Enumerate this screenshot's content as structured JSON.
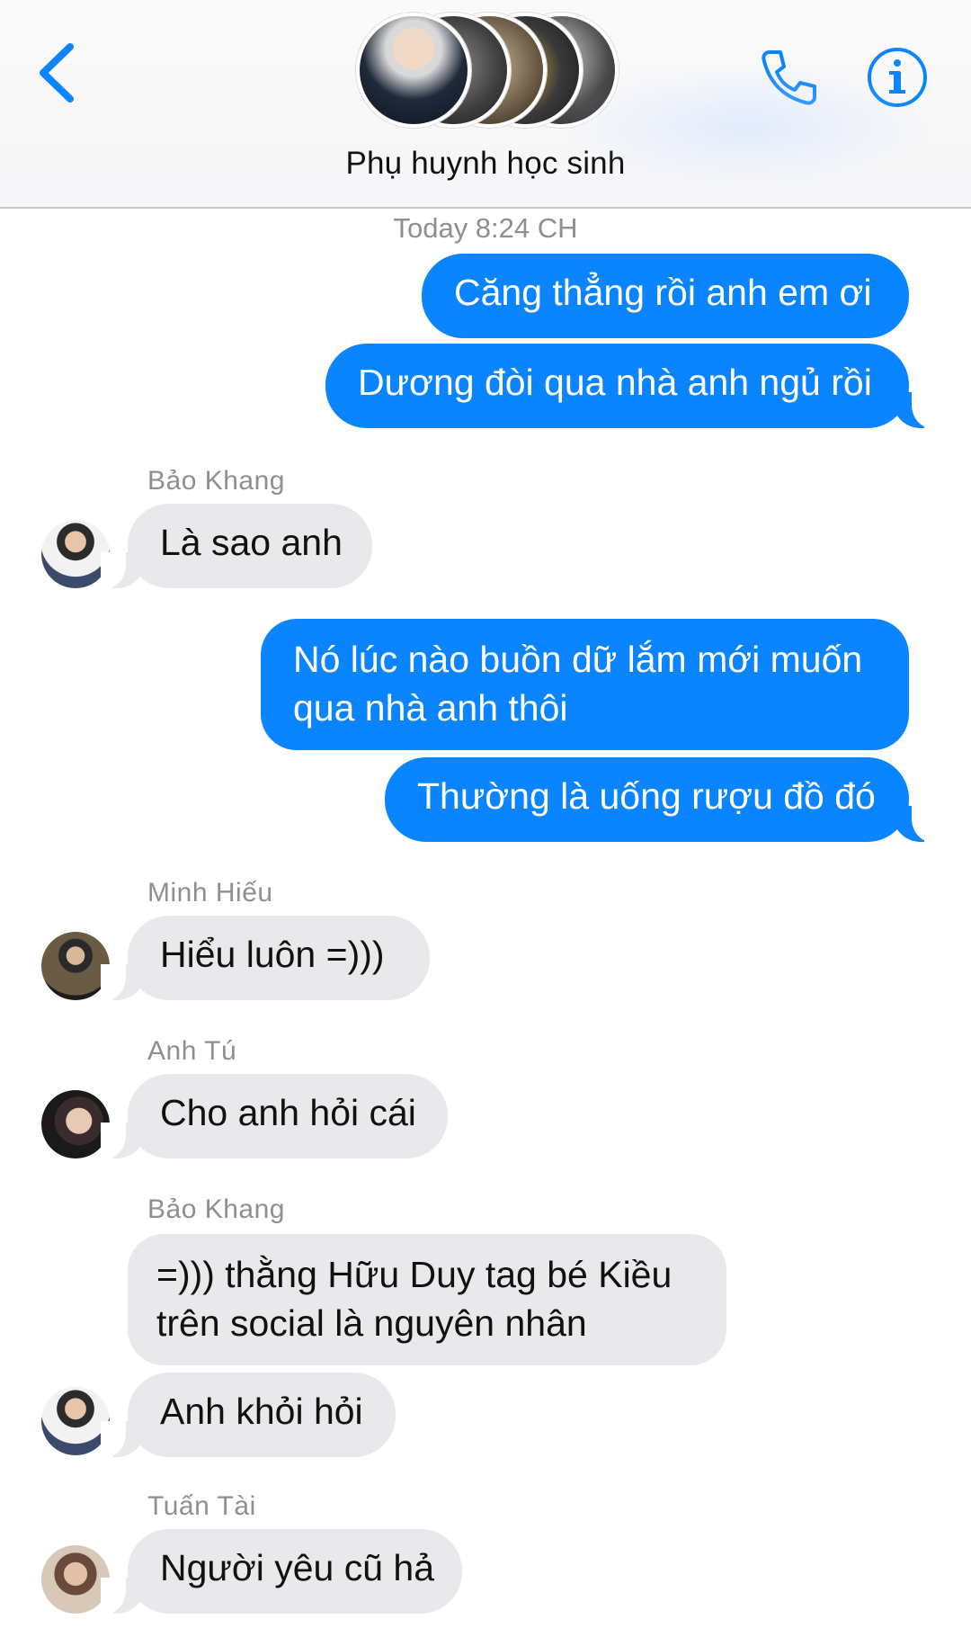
{
  "header": {
    "back_icon": "chevron-left-icon",
    "call_icon": "phone-icon",
    "info_icon": "info-icon",
    "group_name": "Phụ huynh học sinh",
    "accent": "#0a84ff"
  },
  "timestamp": "Today 8:24 CH",
  "messages": [
    {
      "dir": "out",
      "text": "Căng thẳng rồi anh em ơi"
    },
    {
      "dir": "out",
      "text": "Dương đòi qua nhà anh ngủ rồi"
    },
    {
      "dir": "in",
      "sender": "Bảo Khang",
      "text": "Là sao anh"
    },
    {
      "dir": "out",
      "text_line1": "Nó lúc nào buồn dữ lắm mới muốn",
      "text_line2": "qua nhà anh thôi"
    },
    {
      "dir": "out",
      "text": "Thường là uống rượu đồ đó"
    },
    {
      "dir": "in",
      "sender": "Minh Hiếu",
      "text": "Hiểu luôn =)))"
    },
    {
      "dir": "in",
      "sender": "Anh Tú",
      "text": "Cho anh hỏi cái"
    },
    {
      "dir": "in",
      "sender": "Bảo Khang",
      "text_line1": "=))) thằng Hữu Duy tag bé Kiều",
      "text_line2": "trên social là nguyên nhân"
    },
    {
      "dir": "in",
      "text": "Anh khỏi hỏi"
    },
    {
      "dir": "in",
      "sender": "Tuấn Tài",
      "text": "Người yêu cũ hả"
    }
  ],
  "colors": {
    "outgoing_bubble": "#0a84ff",
    "incoming_bubble": "#e9e9eb",
    "meta_text": "#8e8e93"
  }
}
